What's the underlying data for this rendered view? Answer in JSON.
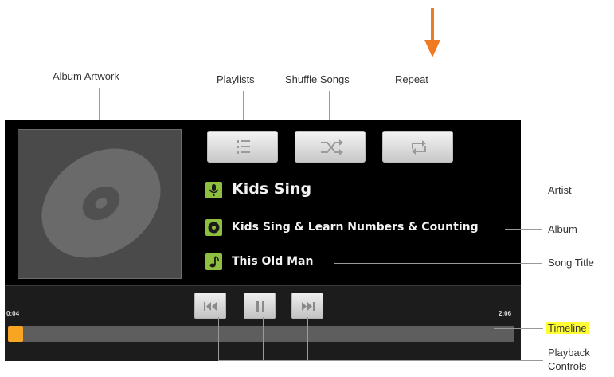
{
  "callouts": {
    "album_artwork": "Album Artwork",
    "playlists": "Playlists",
    "shuffle_songs": "Shuffle Songs",
    "repeat": "Repeat",
    "artist": "Artist",
    "album": "Album",
    "song_title": "Song Title",
    "timeline": "Timeline",
    "playback_controls_line1": "Playback",
    "playback_controls_line2": "Controls"
  },
  "track": {
    "artist": "Kids Sing",
    "album": "Kids Sing & Learn Numbers & Counting",
    "song_title": "This Old Man"
  },
  "timeline": {
    "elapsed": "0:04",
    "total": "2:06",
    "progress_fraction": 0.03
  },
  "icons": {
    "playlists": "playlist-icon",
    "shuffle": "shuffle-icon",
    "repeat": "repeat-icon",
    "artist": "microphone-icon",
    "album": "disc-icon",
    "song": "music-note-icon",
    "previous": "previous-icon",
    "pause": "pause-icon",
    "next": "next-icon"
  },
  "colors": {
    "player_background": "#000000",
    "info_icon": "#8fbf3e",
    "progress": "#f6a623",
    "highlight": "#ffff33",
    "arrow": "#f07a22"
  }
}
